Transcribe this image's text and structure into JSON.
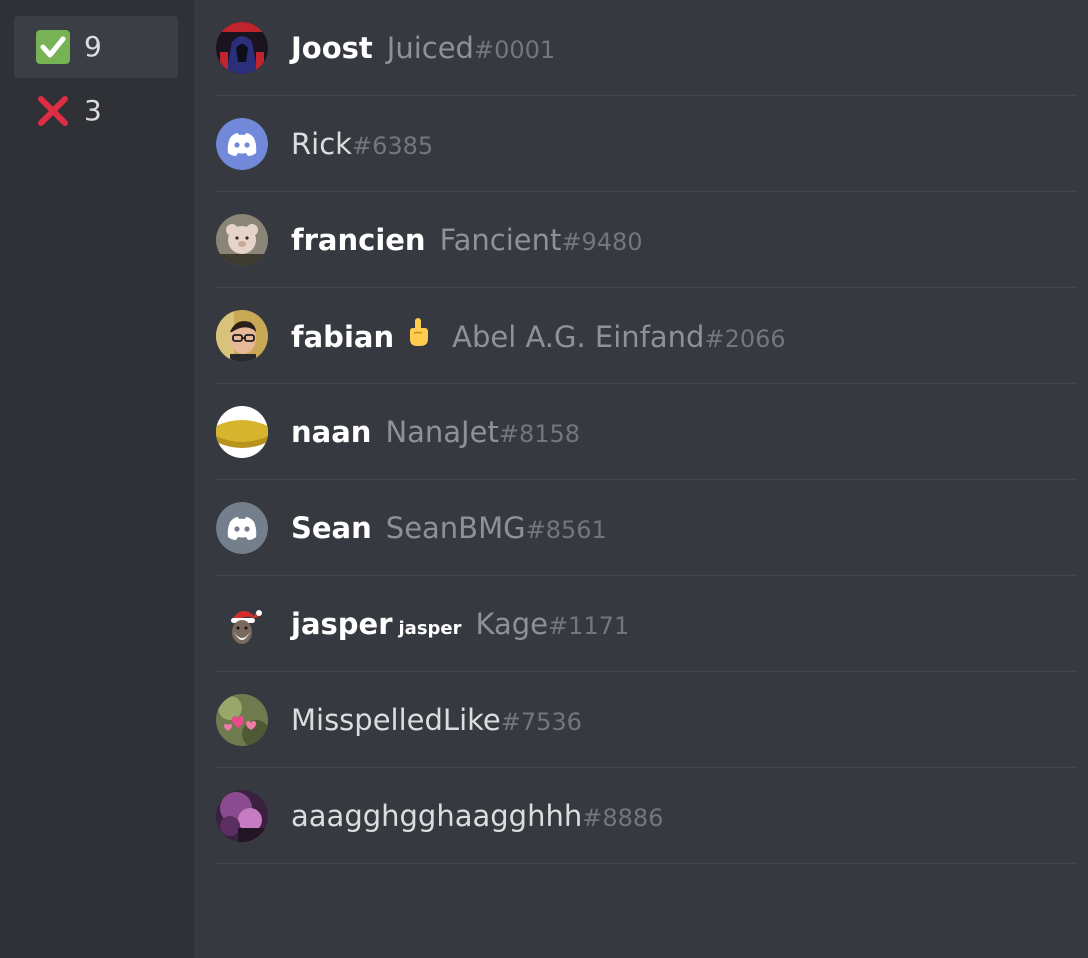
{
  "reactions": [
    {
      "emoji": "check-mark-icon",
      "count": "9",
      "selected": true,
      "color": "#77b255"
    },
    {
      "emoji": "cross-mark-icon",
      "count": "3",
      "selected": false,
      "color": "#dd2e44"
    }
  ],
  "users": [
    {
      "nickname": "Joost",
      "username": "Juiced",
      "discriminator": "#0001",
      "avatar": "red-hood-avatar"
    },
    {
      "nickname": "",
      "username": "Rick",
      "discriminator": "#6385",
      "avatar": "default-discord-blurple-avatar"
    },
    {
      "nickname": "francien",
      "username": "Fancient",
      "discriminator": "#9480",
      "avatar": "plush-bear-avatar"
    },
    {
      "nickname": "fabian",
      "nickname_emoji": "pointing-up-icon",
      "username": "Abel A.G. Einfand",
      "discriminator": "#2066",
      "avatar": "glasses-man-avatar"
    },
    {
      "nickname": "naan",
      "username": "NanaJet",
      "discriminator": "#8158",
      "avatar": "banana-avatar"
    },
    {
      "nickname": "Sean",
      "username": "SeanBMG",
      "discriminator": "#8561",
      "avatar": "default-discord-grey-avatar"
    },
    {
      "nickname": "jasper",
      "nickname_suffix": "jasper",
      "username": "Kage",
      "discriminator": "#1171",
      "avatar": "santa-hat-avatar"
    },
    {
      "nickname": "",
      "username": "MisspelledLike",
      "discriminator": "#7536",
      "avatar": "pink-hearts-avatar"
    },
    {
      "nickname": "",
      "username": "aaagghgghaagghhh",
      "discriminator": "#8886",
      "avatar": "purple-scene-avatar"
    }
  ],
  "colors": {
    "background": "#36393f",
    "sidebar": "#2f3136",
    "blurple": "#7289da",
    "grey": "#747f8d"
  }
}
